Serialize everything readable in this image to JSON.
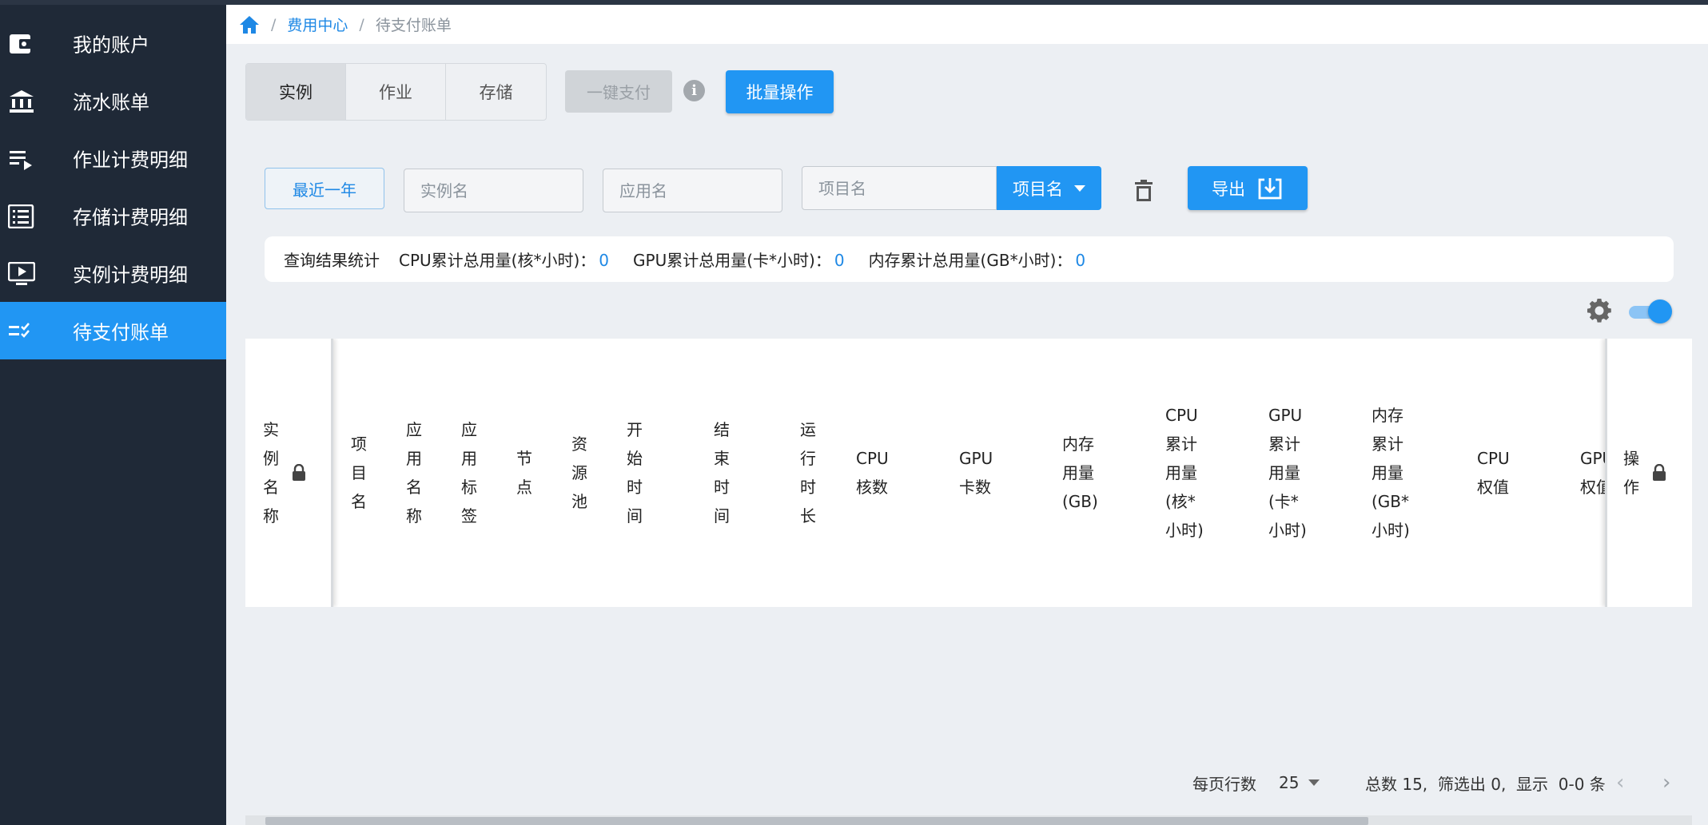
{
  "sidebar": {
    "items": [
      {
        "label": "我的账户",
        "icon": "wallet-icon"
      },
      {
        "label": "流水账单",
        "icon": "bank-icon"
      },
      {
        "label": "作业计费明细",
        "icon": "playlist-icon"
      },
      {
        "label": "存储计费明细",
        "icon": "storage-list-icon"
      },
      {
        "label": "实例计费明细",
        "icon": "monitor-play-icon"
      },
      {
        "label": "待支付账单",
        "icon": "checklist-icon",
        "active": true
      }
    ]
  },
  "breadcrumb": {
    "home_icon": "home-icon",
    "parent": "费用中心",
    "current": "待支付账单"
  },
  "tabs": [
    {
      "label": "实例",
      "active": true
    },
    {
      "label": "作业"
    },
    {
      "label": "存储"
    }
  ],
  "toolbar": {
    "pay_label": "一键支付",
    "info_glyph": "i",
    "batch_label": "批量操作"
  },
  "filters": {
    "range_label": "最近一年",
    "instance_placeholder": "实例名",
    "app_placeholder": "应用名",
    "project_placeholder": "项目名",
    "project_select_label": "项目名",
    "export_label": "导出"
  },
  "stats": {
    "title": "查询结果统计",
    "cpu_label": "CPU累计总用量(核*小时)：",
    "cpu_value": "0",
    "gpu_label": "GPU累计总用量(卡*小时)：",
    "gpu_value": "0",
    "mem_label": "内存累计总用量(GB*小时)：",
    "mem_value": "0"
  },
  "table": {
    "columns": [
      "实例名称",
      "项目名",
      "应用名称",
      "应用标签",
      "节点",
      "资源池",
      "开始时间",
      "结束时间",
      "运行时长",
      "CPU核数",
      "GPU卡数",
      "内存用量(GB)",
      "CPU累计用量(核*小时)",
      "GPU累计用量(卡*小时)",
      "内存累计用量(GB*小时)",
      "CPU权值",
      "GPU权值",
      "操作"
    ]
  },
  "pagination": {
    "rows_label": "每页行数",
    "rows_value": "25",
    "info": "总数 15,  筛选出 0,  显示  0-0 条",
    "prev": "‹",
    "next": "›"
  },
  "colors": {
    "primary": "#2196f3",
    "sidebar_bg": "#1f2937",
    "link": "#1e88e5"
  }
}
